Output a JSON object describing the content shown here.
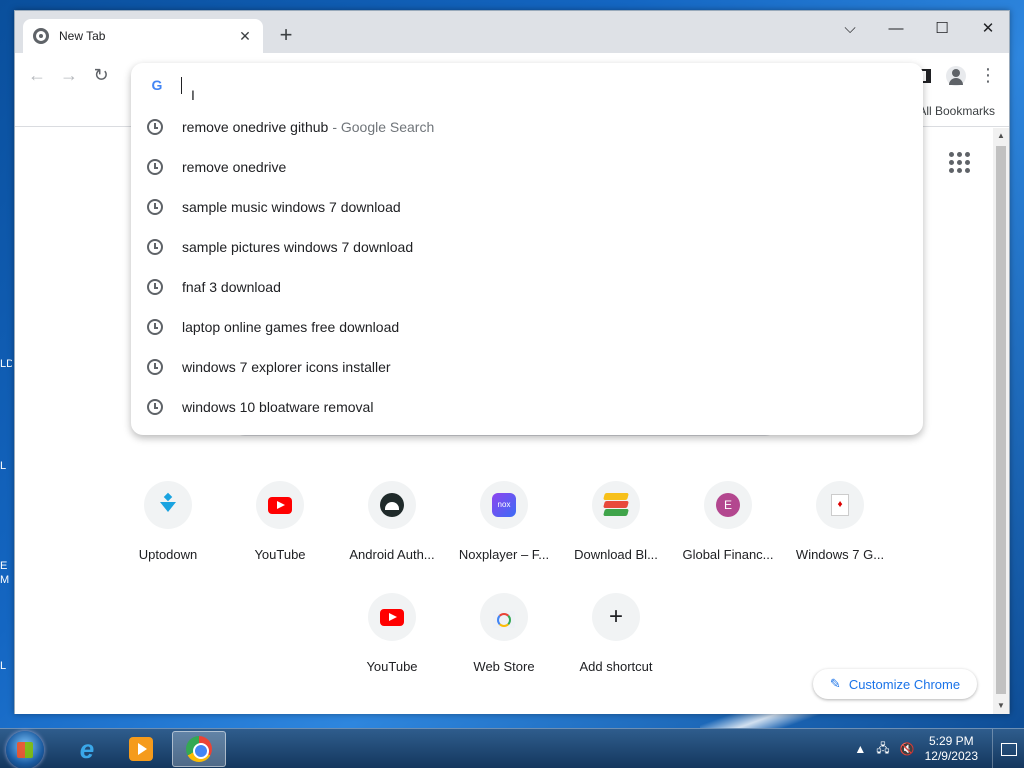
{
  "desktop": {
    "fragments": [
      "LD",
      "L",
      "E",
      "M",
      "L"
    ]
  },
  "browser": {
    "tab": {
      "title": "New Tab",
      "close": "✕"
    },
    "new_tab": "+",
    "window_controls": {
      "tab_search": "⌵",
      "minimize": "—",
      "maximize": "☐",
      "close": "✕"
    },
    "nav": {
      "back": "←",
      "forward": "→",
      "reload": "↻"
    },
    "menu": "⋮",
    "bookmarks": {
      "all_bookmarks": "All Bookmarks"
    }
  },
  "omnibox": {
    "value": "",
    "suggestions": [
      {
        "text": "remove onedrive github",
        "suffix": "- Google Search"
      },
      {
        "text": "remove onedrive",
        "suffix": ""
      },
      {
        "text": "sample music windows 7 download",
        "suffix": ""
      },
      {
        "text": "sample pictures windows 7 download",
        "suffix": ""
      },
      {
        "text": "fnaf 3 download",
        "suffix": ""
      },
      {
        "text": "laptop online games free download",
        "suffix": ""
      },
      {
        "text": "windows 7 explorer icons installer",
        "suffix": ""
      },
      {
        "text": "windows 10 bloatware removal",
        "suffix": ""
      }
    ]
  },
  "new_tab_page": {
    "shortcuts": [
      {
        "title": "Uptodown",
        "icon": "uptodown-icon"
      },
      {
        "title": "YouTube",
        "icon": "youtube-icon"
      },
      {
        "title": "Android Auth...",
        "icon": "android-authority-icon"
      },
      {
        "title": "Noxplayer – F...",
        "icon": "noxplayer-icon",
        "glyph": "nox"
      },
      {
        "title": "Download Bl...",
        "icon": "bluestacks-icon"
      },
      {
        "title": "Global Financ...",
        "icon": "global-finance-icon",
        "glyph": "E"
      },
      {
        "title": "Windows 7 G...",
        "icon": "windows7-games-icon",
        "glyph": "♦"
      },
      {
        "title": "YouTube",
        "icon": "youtube-icon"
      },
      {
        "title": "Web Store",
        "icon": "web-store-icon"
      },
      {
        "title": "Add shortcut",
        "icon": "plus-icon",
        "glyph": "+"
      }
    ],
    "customize_label": "Customize Chrome",
    "pencil_glyph": "✎"
  },
  "taskbar": {
    "time": "5:29 PM",
    "date": "12/9/2023",
    "tray_arrow": "▲",
    "ie_glyph": "e"
  },
  "colors": {
    "accent": "#1a73e8",
    "youtube": "#ff0000",
    "taskbar": "#2f5d8d"
  }
}
